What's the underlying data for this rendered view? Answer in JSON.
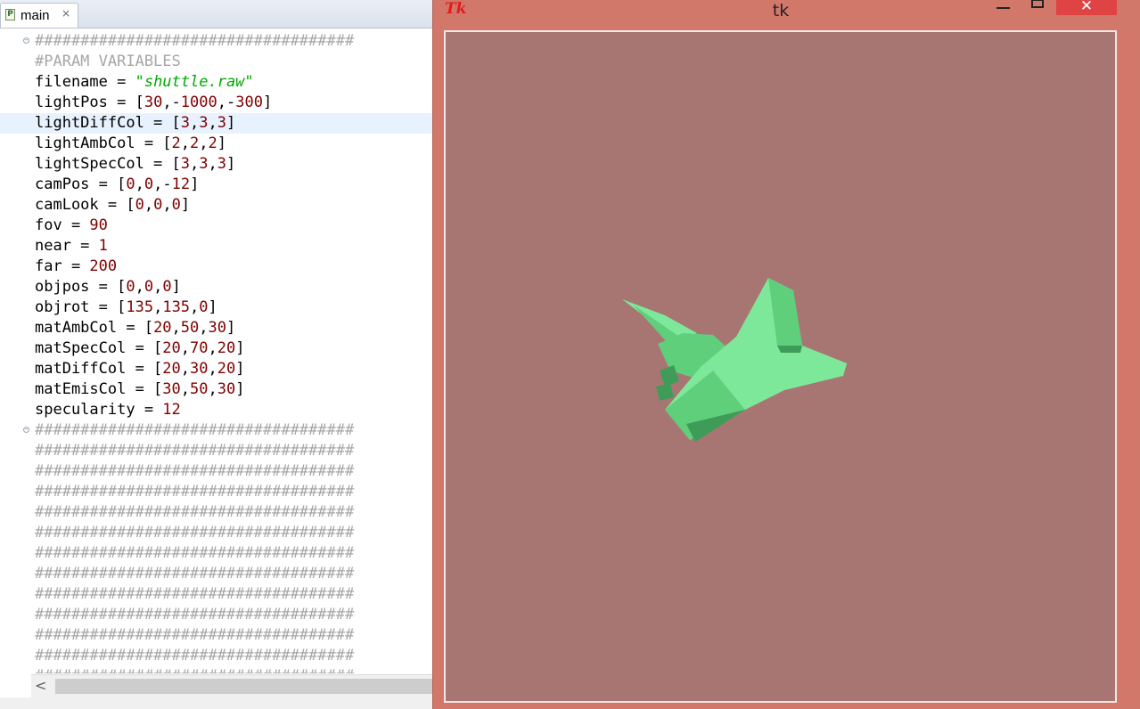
{
  "editor": {
    "tab": {
      "label": "main",
      "close_glyph": "×",
      "icon": "python-file-icon"
    },
    "lines": [
      {
        "fold": true,
        "current": false,
        "tokens": [
          {
            "t": "comment",
            "v": "###################################"
          }
        ]
      },
      {
        "fold": false,
        "current": false,
        "tokens": [
          {
            "t": "comment",
            "v": "#PARAM VARIABLES"
          }
        ]
      },
      {
        "fold": false,
        "current": false,
        "tokens": [
          {
            "t": "plain",
            "v": "filename = "
          },
          {
            "t": "str",
            "v": "\"shuttle.raw\""
          }
        ]
      },
      {
        "fold": false,
        "current": false,
        "tokens": [
          {
            "t": "plain",
            "v": "lightPos = ["
          },
          {
            "t": "num",
            "v": "30"
          },
          {
            "t": "plain",
            "v": ",-"
          },
          {
            "t": "num",
            "v": "1000"
          },
          {
            "t": "plain",
            "v": ",-"
          },
          {
            "t": "num",
            "v": "300"
          },
          {
            "t": "plain",
            "v": "]"
          }
        ]
      },
      {
        "fold": false,
        "current": true,
        "tokens": [
          {
            "t": "plain",
            "v": "lightDiffCol = ["
          },
          {
            "t": "num",
            "v": "3"
          },
          {
            "t": "plain",
            "v": ","
          },
          {
            "t": "num",
            "v": "3"
          },
          {
            "t": "plain",
            "v": ","
          },
          {
            "t": "num",
            "v": "3"
          },
          {
            "t": "plain",
            "v": "]"
          }
        ]
      },
      {
        "fold": false,
        "current": false,
        "tokens": [
          {
            "t": "plain",
            "v": "lightAmbCol = ["
          },
          {
            "t": "num",
            "v": "2"
          },
          {
            "t": "plain",
            "v": ","
          },
          {
            "t": "num",
            "v": "2"
          },
          {
            "t": "plain",
            "v": ","
          },
          {
            "t": "num",
            "v": "2"
          },
          {
            "t": "plain",
            "v": "]"
          }
        ]
      },
      {
        "fold": false,
        "current": false,
        "tokens": [
          {
            "t": "plain",
            "v": "lightSpecCol = ["
          },
          {
            "t": "num",
            "v": "3"
          },
          {
            "t": "plain",
            "v": ","
          },
          {
            "t": "num",
            "v": "3"
          },
          {
            "t": "plain",
            "v": ","
          },
          {
            "t": "num",
            "v": "3"
          },
          {
            "t": "plain",
            "v": "]"
          }
        ]
      },
      {
        "fold": false,
        "current": false,
        "tokens": [
          {
            "t": "plain",
            "v": "camPos = ["
          },
          {
            "t": "num",
            "v": "0"
          },
          {
            "t": "plain",
            "v": ","
          },
          {
            "t": "num",
            "v": "0"
          },
          {
            "t": "plain",
            "v": ",-"
          },
          {
            "t": "num",
            "v": "12"
          },
          {
            "t": "plain",
            "v": "]"
          }
        ]
      },
      {
        "fold": false,
        "current": false,
        "tokens": [
          {
            "t": "plain",
            "v": "camLook = ["
          },
          {
            "t": "num",
            "v": "0"
          },
          {
            "t": "plain",
            "v": ","
          },
          {
            "t": "num",
            "v": "0"
          },
          {
            "t": "plain",
            "v": ","
          },
          {
            "t": "num",
            "v": "0"
          },
          {
            "t": "plain",
            "v": "]"
          }
        ]
      },
      {
        "fold": false,
        "current": false,
        "tokens": [
          {
            "t": "plain",
            "v": "fov = "
          },
          {
            "t": "num",
            "v": "90"
          }
        ]
      },
      {
        "fold": false,
        "current": false,
        "tokens": [
          {
            "t": "plain",
            "v": "near = "
          },
          {
            "t": "num",
            "v": "1"
          }
        ]
      },
      {
        "fold": false,
        "current": false,
        "tokens": [
          {
            "t": "plain",
            "v": "far = "
          },
          {
            "t": "num",
            "v": "200"
          }
        ]
      },
      {
        "fold": false,
        "current": false,
        "tokens": [
          {
            "t": "plain",
            "v": "objpos = ["
          },
          {
            "t": "num",
            "v": "0"
          },
          {
            "t": "plain",
            "v": ","
          },
          {
            "t": "num",
            "v": "0"
          },
          {
            "t": "plain",
            "v": ","
          },
          {
            "t": "num",
            "v": "0"
          },
          {
            "t": "plain",
            "v": "]"
          }
        ]
      },
      {
        "fold": false,
        "current": false,
        "tokens": [
          {
            "t": "plain",
            "v": "objrot = ["
          },
          {
            "t": "num",
            "v": "135"
          },
          {
            "t": "plain",
            "v": ","
          },
          {
            "t": "num",
            "v": "135"
          },
          {
            "t": "plain",
            "v": ","
          },
          {
            "t": "num",
            "v": "0"
          },
          {
            "t": "plain",
            "v": "]"
          }
        ]
      },
      {
        "fold": false,
        "current": false,
        "tokens": [
          {
            "t": "plain",
            "v": "matAmbCol = ["
          },
          {
            "t": "num",
            "v": "20"
          },
          {
            "t": "plain",
            "v": ","
          },
          {
            "t": "num",
            "v": "50"
          },
          {
            "t": "plain",
            "v": ","
          },
          {
            "t": "num",
            "v": "30"
          },
          {
            "t": "plain",
            "v": "]"
          }
        ]
      },
      {
        "fold": false,
        "current": false,
        "tokens": [
          {
            "t": "plain",
            "v": "matSpecCol = ["
          },
          {
            "t": "num",
            "v": "20"
          },
          {
            "t": "plain",
            "v": ","
          },
          {
            "t": "num",
            "v": "70"
          },
          {
            "t": "plain",
            "v": ","
          },
          {
            "t": "num",
            "v": "20"
          },
          {
            "t": "plain",
            "v": "]"
          }
        ]
      },
      {
        "fold": false,
        "current": false,
        "tokens": [
          {
            "t": "plain",
            "v": "matDiffCol = ["
          },
          {
            "t": "num",
            "v": "20"
          },
          {
            "t": "plain",
            "v": ","
          },
          {
            "t": "num",
            "v": "30"
          },
          {
            "t": "plain",
            "v": ","
          },
          {
            "t": "num",
            "v": "20"
          },
          {
            "t": "plain",
            "v": "]"
          }
        ]
      },
      {
        "fold": false,
        "current": false,
        "tokens": [
          {
            "t": "plain",
            "v": "matEmisCol = ["
          },
          {
            "t": "num",
            "v": "30"
          },
          {
            "t": "plain",
            "v": ","
          },
          {
            "t": "num",
            "v": "50"
          },
          {
            "t": "plain",
            "v": ","
          },
          {
            "t": "num",
            "v": "30"
          },
          {
            "t": "plain",
            "v": "]"
          }
        ]
      },
      {
        "fold": false,
        "current": false,
        "tokens": [
          {
            "t": "plain",
            "v": "specularity = "
          },
          {
            "t": "num",
            "v": "12"
          }
        ]
      },
      {
        "fold": true,
        "current": false,
        "tokens": [
          {
            "t": "comment",
            "v": "###################################"
          }
        ]
      },
      {
        "fold": false,
        "current": false,
        "tokens": [
          {
            "t": "comment",
            "v": "###################################"
          }
        ]
      },
      {
        "fold": false,
        "current": false,
        "tokens": [
          {
            "t": "comment",
            "v": "###################################"
          }
        ]
      },
      {
        "fold": false,
        "current": false,
        "tokens": [
          {
            "t": "comment",
            "v": "###################################"
          }
        ]
      },
      {
        "fold": false,
        "current": false,
        "tokens": [
          {
            "t": "comment",
            "v": "###################################"
          }
        ]
      },
      {
        "fold": false,
        "current": false,
        "tokens": [
          {
            "t": "comment",
            "v": "###################################"
          }
        ]
      },
      {
        "fold": false,
        "current": false,
        "tokens": [
          {
            "t": "comment",
            "v": "###################################"
          }
        ]
      },
      {
        "fold": false,
        "current": false,
        "tokens": [
          {
            "t": "comment",
            "v": "###################################"
          }
        ]
      },
      {
        "fold": false,
        "current": false,
        "tokens": [
          {
            "t": "comment",
            "v": "###################################"
          }
        ]
      },
      {
        "fold": false,
        "current": false,
        "tokens": [
          {
            "t": "comment",
            "v": "###################################"
          }
        ]
      },
      {
        "fold": false,
        "current": false,
        "tokens": [
          {
            "t": "comment",
            "v": "###################################"
          }
        ]
      },
      {
        "fold": false,
        "current": false,
        "tokens": [
          {
            "t": "comment",
            "v": "###################################"
          }
        ]
      },
      {
        "fold": false,
        "current": false,
        "tokens": [
          {
            "t": "comment",
            "v": "###################################"
          }
        ]
      }
    ],
    "scroll_left_glyph": "<"
  },
  "tk_window": {
    "title": "tk",
    "logo_text": "Tk",
    "close_glyph": "✕",
    "colors": {
      "frame": "#d2786a",
      "canvas_bg": "#a77673",
      "shuttle_light": "#7ee89a",
      "shuttle_mid": "#5fcf7c",
      "shuttle_dark": "#3f9c58"
    },
    "canvas_content": "rendered-shuttle-model"
  }
}
